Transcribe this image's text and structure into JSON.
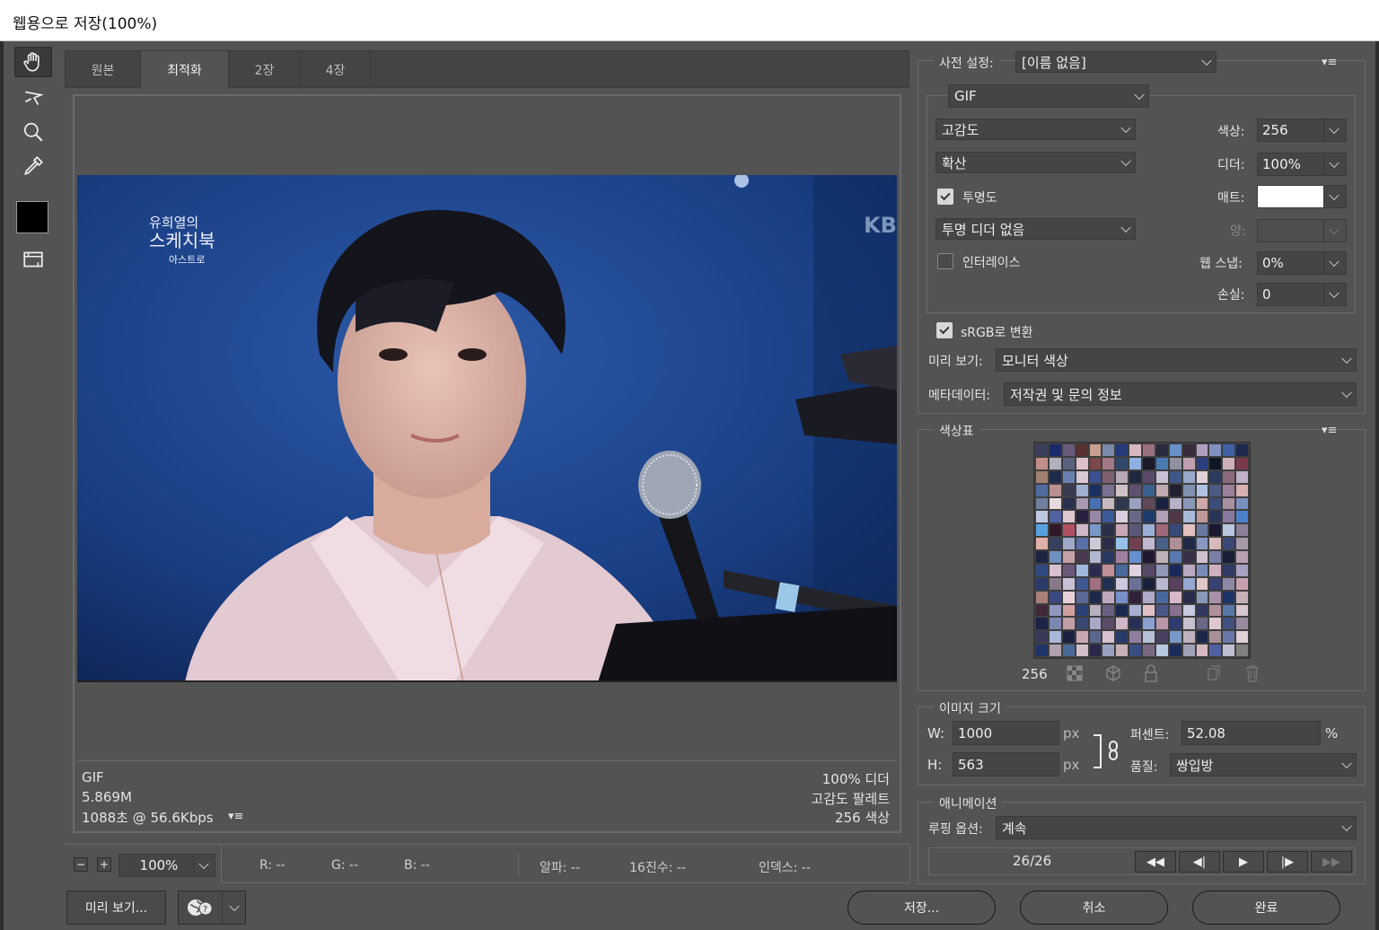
{
  "window": {
    "title": "웹용으로 저장(100%)"
  },
  "tabs": [
    "원본",
    "최적화",
    "2장",
    "4장"
  ],
  "canvas": {
    "image_caption": {
      "line1": "유희열의",
      "line2": "스케치북",
      "line3": "아스트로"
    },
    "watermark": "KB",
    "footer_left": {
      "format": "GIF",
      "size": "5.869M",
      "time": "1088초 @ 56.6Kbps"
    },
    "footer_right": {
      "dither": "100% 디더",
      "palette": "고감도 팔레트",
      "colors": "256 색상"
    }
  },
  "zoom": {
    "minus": "−",
    "plus": "+",
    "value": "100%"
  },
  "pixel_info": {
    "r": "R: --",
    "g": "G: --",
    "b": "B: --",
    "alpha": "알파: --",
    "hex": "16진수: --",
    "index": "인덱스: --"
  },
  "preset": {
    "label": "사전 설정:",
    "value": "[이름 없음]",
    "menu": "▾≡"
  },
  "format": {
    "value": "GIF"
  },
  "reduction": {
    "value": "고감도"
  },
  "dither_algo": {
    "value": "확산"
  },
  "transparency": {
    "label": "투명도",
    "checked": true
  },
  "trans_dither": {
    "value": "투명 디더 없음"
  },
  "interlace": {
    "label": "인터레이스",
    "checked": false
  },
  "colors": {
    "label": "색상:",
    "value": "256"
  },
  "dither": {
    "label": "디더:",
    "value": "100%"
  },
  "matte": {
    "label": "매트:"
  },
  "amount": {
    "label": "양:"
  },
  "web_snap": {
    "label": "웹 스냅:",
    "value": "0%"
  },
  "lossy": {
    "label": "손실:",
    "value": "0"
  },
  "srgb": {
    "label": "sRGB로 변환",
    "checked": true
  },
  "preview": {
    "label": "미리 보기:",
    "value": "모니터 색상"
  },
  "metadata": {
    "label": "메타데이터:",
    "value": "저작권 및 문의 정보"
  },
  "color_table": {
    "title": "색상표",
    "count": "256",
    "menu": "▾≡"
  },
  "image_size": {
    "title": "이미지 크기",
    "w_label": "W:",
    "w_value": "1000",
    "h_label": "H:",
    "h_value": "563",
    "unit": "px",
    "percent_label": "퍼센트:",
    "percent_value": "52.08",
    "percent_sign": "%",
    "quality_label": "품질:",
    "quality_value": "쌍입방"
  },
  "animation": {
    "title": "애니메이션",
    "loop_label": "루핑 옵션:",
    "loop_value": "계속",
    "frame": "26/26",
    "btn_first": "◀◀",
    "btn_prev": "◀|",
    "btn_play": "▶",
    "btn_next": "|▶",
    "btn_last": "▶▶"
  },
  "buttons": {
    "preview": "미리 보기...",
    "save": "저장...",
    "cancel": "취소",
    "done": "완료"
  },
  "palette_colors": [
    "#3a3f5c",
    "#1a2a6a",
    "#6a5a7a",
    "#5a3030",
    "#c8a090",
    "#7a8aa8",
    "#243a7a",
    "#d8b8c0",
    "#9a7080",
    "#2a2a40",
    "#6a90c8",
    "#3a2a3a",
    "#b0a0c0",
    "#8090c0",
    "#4060a8",
    "#1c2850",
    "#c09088",
    "#b0b0c0",
    "#5a6080",
    "#e0c0c8",
    "#7a4a4a",
    "#a07888",
    "#30486a",
    "#8fb0e0",
    "#1a1a2a",
    "#4a7ab0",
    "#9090a0",
    "#c0a0b0",
    "#2a4080",
    "#101828",
    "#d0b0b8",
    "#7a3a4a",
    "#a08070",
    "#1e2a4a",
    "#6a80b0",
    "#d8c8d0",
    "#3a5090",
    "#806070",
    "#b8a8b8",
    "#202840",
    "#5a4a6a",
    "#c8c0d0",
    "#405888",
    "#98a8c8",
    "#e0d0d8",
    "#2c3a60",
    "#8a6a7a",
    "#c0b0c8",
    "#506aa0",
    "#b89090",
    "#3a3a50",
    "#a0b0d0",
    "#1a3060",
    "#7a7090",
    "#d0c0c8",
    "#605070",
    "#3a6090",
    "#c0a8b0",
    "#202030",
    "#8090b0",
    "#b0c0e0",
    "#4a5a80",
    "#9a8098",
    "#d8b0b0",
    "#7080a0",
    "#e8d8e0",
    "#2a3050",
    "#a898b0",
    "#4870b0",
    "#c8b8c0",
    "#303850",
    "#9aa0c0",
    "#604858",
    "#1a2040",
    "#b8b0c8",
    "#8a98b8",
    "#d0a8a8",
    "#3c4c78",
    "#a890a0",
    "#7a90c0",
    "#c0c8e0",
    "#5060a0",
    "#e0c8d0",
    "#2a2040",
    "#9888a8",
    "#3a5a98",
    "#d8d0e0",
    "#6a6888",
    "#1c3c70",
    "#b0a0b8",
    "#503848",
    "#a8b8d8",
    "#c09898",
    "#283458",
    "#8878a0",
    "#4a80c8",
    "#58a0e0",
    "#301828",
    "#b05060",
    "#d0b8c8",
    "#7a98c8",
    "#28304a",
    "#c8a8b8",
    "#5a5878",
    "#9ab0d8",
    "#a06878",
    "#384878",
    "#e0c0c0",
    "#6878a0",
    "#1a1830",
    "#b8c8e0",
    "#8a8098",
    "#e0b0a8",
    "#384060",
    "#a0a8c8",
    "#5870a8",
    "#d0c8d8",
    "#2c2c48",
    "#98c0e8",
    "#704050",
    "#c0b8d0",
    "#486088",
    "#b09098",
    "#202848",
    "#8898c0",
    "#d8b8b8",
    "#3a4878",
    "#a898a8",
    "#1c2440",
    "#7090c0",
    "#c8a0a8",
    "#4a3850",
    "#b0b8d0",
    "#283860",
    "#a080a0",
    "#6890d0",
    "#201830",
    "#c0b0b8",
    "#5878b0",
    "#383048",
    "#d0c0d0",
    "#7880a8",
    "#182038",
    "#b8a0b0",
    "#304880",
    "#d8c0d0",
    "#6a5878",
    "#a0b8e0",
    "#2a2a50",
    "#c09098",
    "#486898",
    "#e0d0e0",
    "#584868",
    "#9098b8",
    "#1a2858",
    "#b8a8c0",
    "#788ab8",
    "#d0b0c0",
    "#303a68",
    "#a8a0c0",
    "#2a3a6a",
    "#887888",
    "#c8c0d8",
    "#405890",
    "#a07080",
    "#203050",
    "#d0c8e0",
    "#6a7098",
    "#18203a",
    "#b8b8d0",
    "#5a4060",
    "#98a8d0",
    "#e0c8c8",
    "#384070",
    "#9088a8",
    "#c8a0b0",
    "#a88078",
    "#3a4a80",
    "#e8d0d8",
    "#5a6898",
    "#1e2848",
    "#c0a8c0",
    "#7890c8",
    "#302038",
    "#b0a8c8",
    "#4868a0",
    "#d8b8c8",
    "#282c48",
    "#8898b8",
    "#a890a8",
    "#1c3468",
    "#c8b0b8",
    "#402838",
    "#9098c0",
    "#d0a0a0",
    "#2a4078",
    "#b8b0c0",
    "#6a6080",
    "#1a2850",
    "#a8b0d0",
    "#e0c0c8",
    "#4a5888",
    "#887090",
    "#c8c8e0",
    "#303860",
    "#b09098",
    "#5878a8",
    "#d8c8d0",
    "#1a2448",
    "#7888b0",
    "#c0a0a8",
    "#384870",
    "#a8a8c8",
    "#5a4a68",
    "#d0b8c8",
    "#283058",
    "#8aa0d0",
    "#b898a8",
    "#2c3c70",
    "#c8c0d0",
    "#6a6888",
    "#e0c8d0",
    "#405080",
    "#9a8aa0",
    "#3a3858",
    "#a8b8d8",
    "#1c2040",
    "#c8a8b0",
    "#5a6890",
    "#d8c0d0",
    "#283a68",
    "#9080a0",
    "#b8c0d8",
    "#4a4060",
    "#7898c8",
    "#c0b0c0",
    "#1a2848",
    "#a89098",
    "#6878a8",
    "#e0d0d8",
    "#203468",
    "#b0a0b0",
    "#4a6898",
    "#d0c0c8",
    "#2a2848",
    "#98a0c0",
    "#c8b0b8",
    "#3a4c80",
    "#7a6880",
    "#b8c8e0",
    "#1c2c58",
    "#a0a0b8",
    "#d8b8c0",
    "#5060a0",
    "#c0c0d0",
    "#808080"
  ]
}
